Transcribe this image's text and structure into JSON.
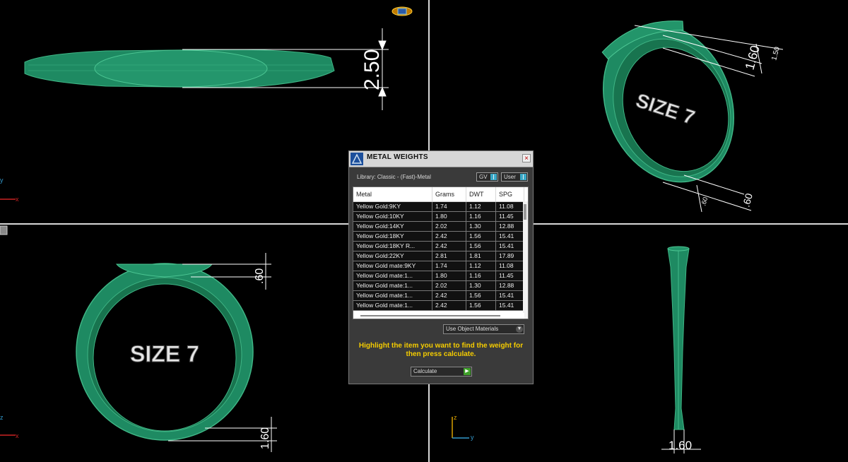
{
  "dialog": {
    "title": "METAL WEIGHTS",
    "close_label": "×",
    "library": "Library: Classic - (Fast)-Metal",
    "gv_label": "GV",
    "user_label": "User",
    "columns": [
      "Metal",
      "Grams",
      "DWT",
      "SPG"
    ],
    "rows": [
      [
        "Yellow Gold:9KY",
        "1.74",
        "1.12",
        "11.08"
      ],
      [
        "Yellow Gold:10KY",
        "1.80",
        "1.16",
        "11.45"
      ],
      [
        "Yellow Gold:14KY",
        "2.02",
        "1.30",
        "12.88"
      ],
      [
        "Yellow Gold:18KY",
        "2.42",
        "1.56",
        "15.41"
      ],
      [
        "Yellow Gold:18KY R...",
        "2.42",
        "1.56",
        "15.41"
      ],
      [
        "Yellow Gold:22KY",
        "2.81",
        "1.81",
        "17.89"
      ],
      [
        "Yellow Gold mate:9KY",
        "1.74",
        "1.12",
        "11.08"
      ],
      [
        "Yellow Gold mate:1...",
        "1.80",
        "1.16",
        "11.45"
      ],
      [
        "Yellow Gold mate:1...",
        "2.02",
        "1.30",
        "12.88"
      ],
      [
        "Yellow Gold mate:1...",
        "2.42",
        "1.56",
        "15.41"
      ],
      [
        "Yellow Gold mate:1...",
        "2.42",
        "1.56",
        "15.41"
      ]
    ],
    "materials_option": "Use Object Materials",
    "hint": "Highlight the item you want to find the weight for then press calculate.",
    "calculate_label": "Calculate"
  },
  "viewports": {
    "top_left": {
      "dimension": "2.50"
    },
    "top_right": {
      "size_text": "SIZE 7",
      "dimensions": [
        "1.60",
        "1.50",
        ".60",
        ".60"
      ]
    },
    "bottom_left": {
      "size_text": "SIZE 7",
      "dimensions": [
        ".60",
        "1.60"
      ],
      "axis_x": "x",
      "axis_z": "z"
    },
    "bottom_right": {
      "dimension": "1.60",
      "axis_z": "z",
      "axis_y": "y"
    }
  },
  "colors": {
    "ring": "#1e8a62",
    "dimension": "#ffffff",
    "hint": "#f5cc00",
    "background": "#000000"
  }
}
